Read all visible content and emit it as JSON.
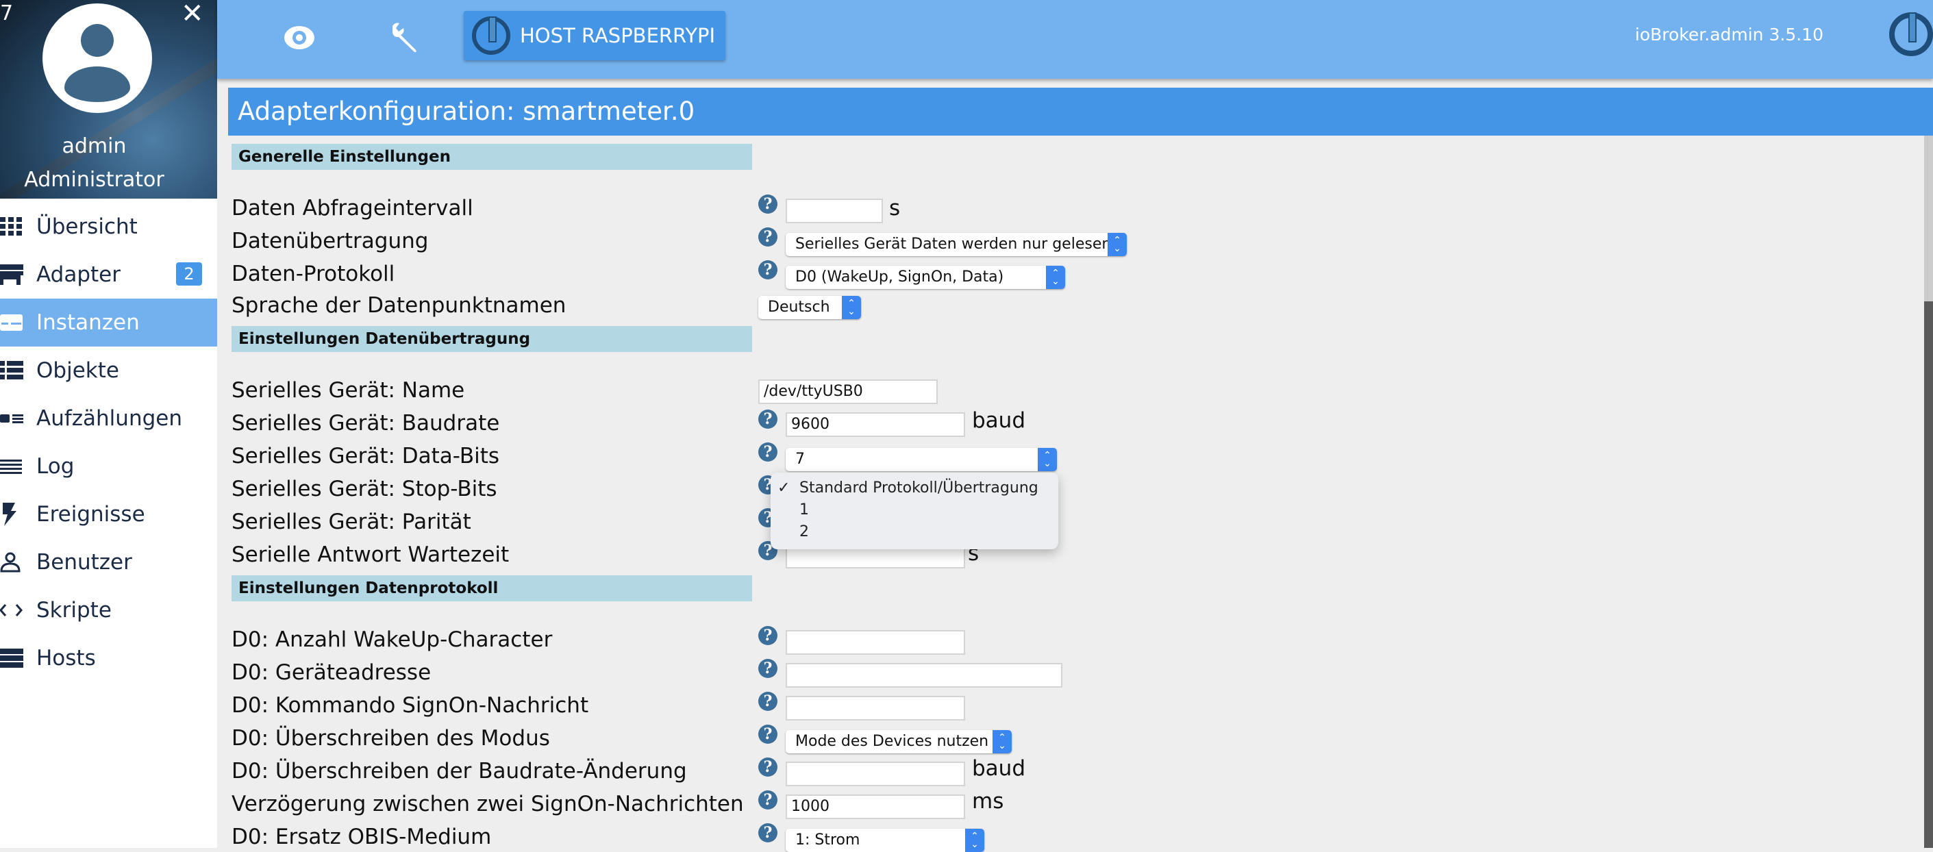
{
  "sidebar": {
    "corner_number": "7",
    "user_name": "admin",
    "user_role": "Administrator",
    "items": [
      {
        "label": "Übersicht",
        "icon": "grid-icon"
      },
      {
        "label": "Adapter",
        "icon": "store-icon",
        "badge": "2"
      },
      {
        "label": "Instanzen",
        "icon": "instances-icon",
        "active": true
      },
      {
        "label": "Objekte",
        "icon": "list-icon"
      },
      {
        "label": "Aufzählungen",
        "icon": "enum-icon"
      },
      {
        "label": "Log",
        "icon": "lines-icon"
      },
      {
        "label": "Ereignisse",
        "icon": "bolt-icon"
      },
      {
        "label": "Benutzer",
        "icon": "user-icon"
      },
      {
        "label": "Skripte",
        "icon": "code-icon"
      },
      {
        "label": "Hosts",
        "icon": "server-icon"
      }
    ]
  },
  "topbar": {
    "host_button": "HOST RASPBERRYPI",
    "version": "ioBroker.admin 3.5.10"
  },
  "page": {
    "title": "Adapterkonfiguration: smartmeter.0"
  },
  "sections": {
    "general": "Generelle Einstellungen",
    "transfer": "Einstellungen Datenübertragung",
    "protocol": "Einstellungen Datenprotokoll"
  },
  "fields": {
    "interval": {
      "label": "Daten Abfrageintervall",
      "value": "",
      "unit": "s"
    },
    "transfer": {
      "label": "Datenübertragung",
      "value": "Serielles Gerät Daten werden nur gelesen"
    },
    "protocol": {
      "label": "Daten-Protokoll",
      "value": "D0 (WakeUp, SignOn, Data)"
    },
    "language": {
      "label": "Sprache der Datenpunktnamen",
      "value": "Deutsch"
    },
    "serial_name": {
      "label": "Serielles Gerät: Name",
      "value": "/dev/ttyUSB0"
    },
    "baudrate": {
      "label": "Serielles Gerät: Baudrate",
      "value": "9600",
      "unit": "baud"
    },
    "databits": {
      "label": "Serielles Gerät: Data-Bits",
      "value": "7"
    },
    "stopbits": {
      "label": "Serielles Gerät: Stop-Bits"
    },
    "parity": {
      "label": "Serielles Gerät: Parität"
    },
    "answer_wait": {
      "label": "Serielle Antwort Wartezeit",
      "value": "",
      "unit": "s"
    },
    "wakeup_chars": {
      "label": "D0: Anzahl WakeUp-Character",
      "value": ""
    },
    "device_address": {
      "label": "D0: Geräteadresse",
      "value": ""
    },
    "signon_cmd": {
      "label": "D0: Kommando SignOn-Nachricht",
      "value": ""
    },
    "mode_override": {
      "label": "D0: Überschreiben des Modus",
      "value": "Mode des Devices nutzen"
    },
    "baud_override": {
      "label": "D0: Überschreiben der Baudrate-Änderung",
      "value": "",
      "unit": "baud"
    },
    "signon_delay": {
      "label": "Verzögerung zwischen zwei SignOn-Nachrichten",
      "value": "1000",
      "unit": "ms"
    },
    "obis_medium": {
      "label": "D0: Ersatz OBIS-Medium",
      "value": "1: Strom"
    }
  },
  "stopbits_dropdown": {
    "selected_check": "✓",
    "options": [
      "Standard Protokoll/Übertragung",
      "1",
      "2"
    ]
  }
}
